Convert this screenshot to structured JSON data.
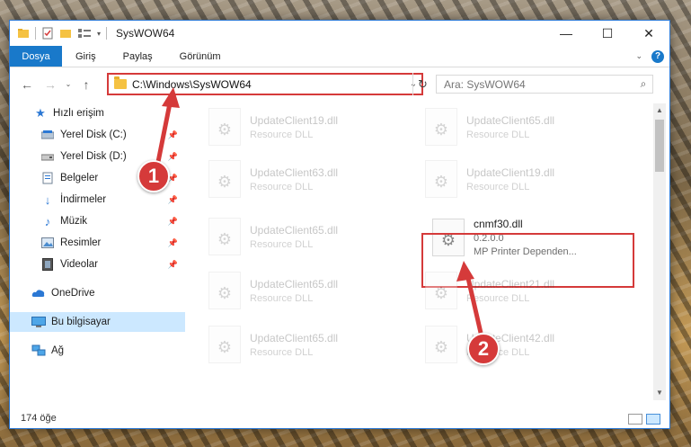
{
  "window": {
    "title": "SysWOW64",
    "controls": {
      "minimize": "—",
      "maximize": "☐",
      "close": "✕"
    }
  },
  "ribbon": {
    "file_tab": "Dosya",
    "tabs": [
      "Giriş",
      "Paylaş",
      "Görünüm"
    ]
  },
  "navigation": {
    "address_path": "C:\\Windows\\SysWOW64",
    "search_placeholder": "Ara: SysWOW64"
  },
  "sidebar": {
    "items": [
      {
        "label": "Hızlı erişim",
        "icon": "star-icon"
      },
      {
        "label": "Yerel Disk (C:)",
        "icon": "drive-icon",
        "pinned": true
      },
      {
        "label": "Yerel Disk (D:)",
        "icon": "drive-icon",
        "pinned": true
      },
      {
        "label": "Belgeler",
        "icon": "documents-icon",
        "pinned": true
      },
      {
        "label": "İndirmeler",
        "icon": "download-icon",
        "pinned": true
      },
      {
        "label": "Müzik",
        "icon": "music-icon",
        "pinned": true
      },
      {
        "label": "Resimler",
        "icon": "pictures-icon",
        "pinned": true
      },
      {
        "label": "Videolar",
        "icon": "videos-icon",
        "pinned": true
      },
      {
        "label": "OneDrive",
        "icon": "cloud-icon"
      },
      {
        "label": "Bu bilgisayar",
        "icon": "computer-icon",
        "selected": true
      },
      {
        "label": "Ağ",
        "icon": "network-icon"
      }
    ]
  },
  "files": [
    {
      "name": "UpdateClient19.dll",
      "sub": "Resource DLL"
    },
    {
      "name": "UpdateClient65.dll",
      "sub": "Resource DLL"
    },
    {
      "name": "UpdateClient63.dll",
      "sub": "Resource DLL"
    },
    {
      "name": "UpdateClient19.dll",
      "sub": "Resource DLL"
    },
    {
      "name": "UpdateClient65.dll",
      "sub": "Resource DLL"
    },
    {
      "name": "cnmf30.dll",
      "sub": "0.2.0.0",
      "sub2": "MP Printer Dependen...",
      "active": true
    },
    {
      "name": "UpdateClient65.dll",
      "sub": "Resource DLL"
    },
    {
      "name": "UpdateClient21.dll",
      "sub": "Resource DLL"
    },
    {
      "name": "UpdateClient65.dll",
      "sub": "Resource DLL"
    },
    {
      "name": "UpdateClient42.dll",
      "sub": "Resource DLL"
    }
  ],
  "status": {
    "item_count": "174 öğe"
  },
  "callouts": {
    "one": "1",
    "two": "2"
  },
  "colors": {
    "accent": "#1979ca",
    "highlight": "#d53a3a",
    "selected": "#cce8ff"
  }
}
